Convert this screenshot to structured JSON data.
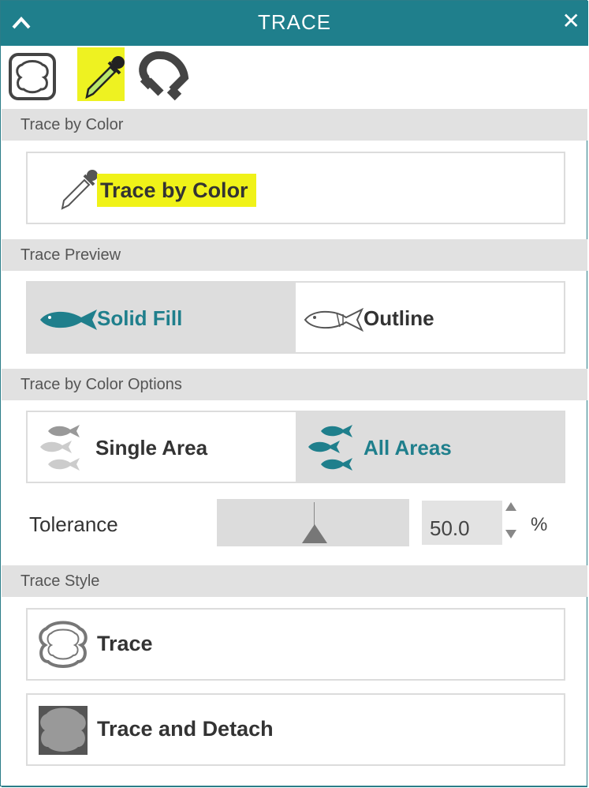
{
  "window": {
    "title": "TRACE",
    "close_glyph": "✕"
  },
  "tool_tabs": [
    {
      "icon": "trace-shape-icon",
      "selected": false
    },
    {
      "icon": "eyedropper-icon",
      "selected": true
    },
    {
      "icon": "magnet-icon",
      "selected": false
    }
  ],
  "sections": {
    "trace_by_color": {
      "header": "Trace by Color",
      "button_label": "Trace by Color"
    },
    "trace_preview": {
      "header": "Trace Preview",
      "options": [
        {
          "label": "Solid Fill",
          "icon": "fish-solid-icon",
          "selected": true
        },
        {
          "label": "Outline",
          "icon": "fish-outline-icon",
          "selected": false
        }
      ]
    },
    "trace_by_color_options": {
      "header": "Trace by Color Options",
      "options": [
        {
          "label": "Single Area",
          "icon": "fish-single-area-icon",
          "selected": false
        },
        {
          "label": "All Areas",
          "icon": "fish-all-areas-icon",
          "selected": true
        }
      ],
      "tolerance": {
        "label": "Tolerance",
        "value": "50.0",
        "unit": "%",
        "slider_fraction": 0.5
      }
    },
    "trace_style": {
      "header": "Trace Style",
      "buttons": [
        {
          "label": "Trace",
          "icon": "trace-outline-icon"
        },
        {
          "label": "Trace and Detach",
          "icon": "trace-detach-icon"
        }
      ]
    }
  },
  "colors": {
    "accent": "#1f7f8c",
    "highlight": "#f0f218",
    "section_bg": "#e1e1e1",
    "selected_bg": "#dddddd"
  }
}
